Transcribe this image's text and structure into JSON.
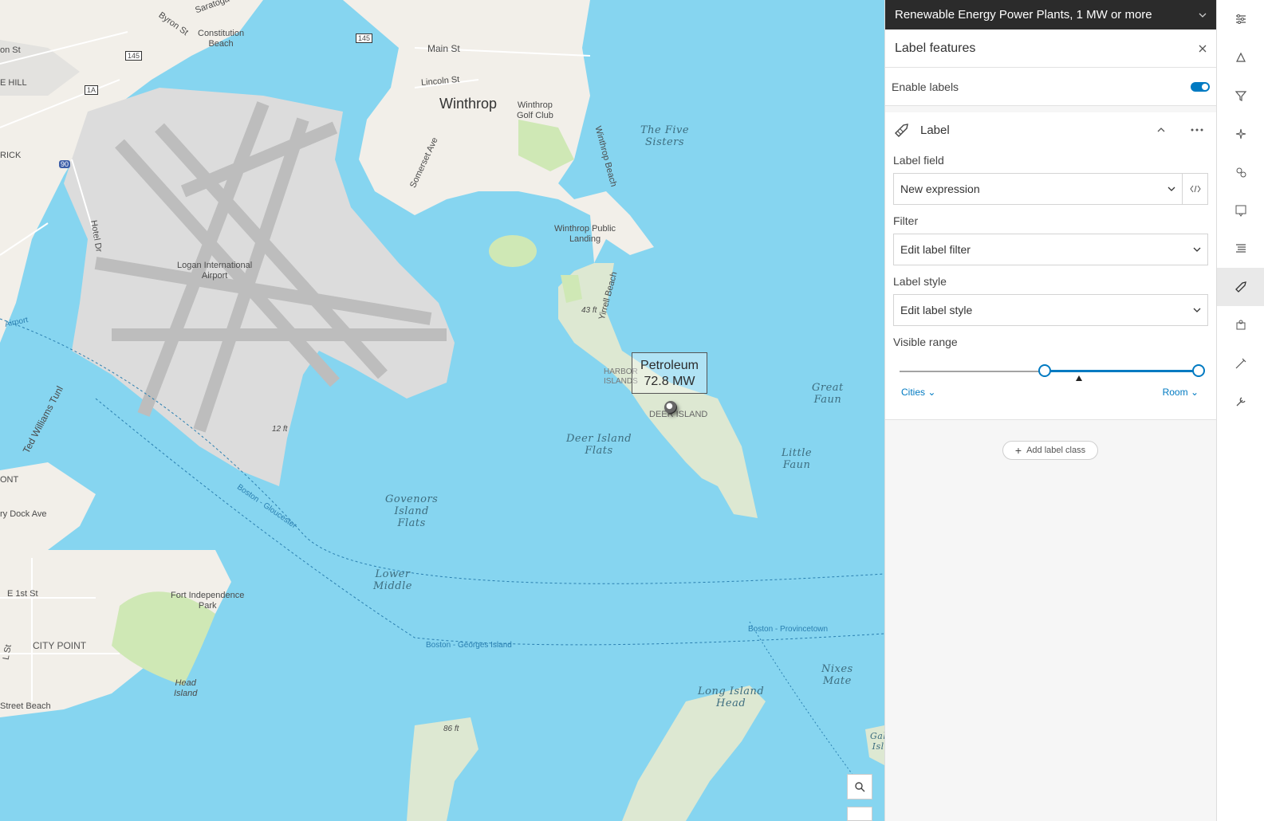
{
  "map": {
    "labels": {
      "constitution_beach": "Constitution\nBeach",
      "byron_st": "Byron St",
      "saratoga": "Saratoga",
      "main_st": "Main St",
      "lincoln_st": "Lincoln St",
      "winthrop": "Winthrop",
      "winthrop_golf": "Winthrop\nGolf Club",
      "winthrop_beach": "Winthrop Beach",
      "five_sisters": "The Five\nSisters",
      "somerset_ave": "Somerset Ave",
      "hotel_dr": "Hotel Dr",
      "logan": "Logan International\nAirport",
      "winthrop_landing": "Winthrop Public\nLanding",
      "yirrell_beach": "Yirrell Beach",
      "elev_43": "43 ft",
      "harbor_islands": "HARBOR\nISLANDS",
      "deer_island": "DEER ISLAND",
      "deer_island_flats": "Deer Island\nFlats",
      "great_faun": "Great\nFaun",
      "little_faun": "Little\nFaun",
      "elev_12": "12 ft",
      "ted_williams": "Ted Williams Tunl",
      "boston_gloucester": "Boston - Gloucester",
      "governors_flats": "Govenors\nIsland\nFlats",
      "lower_middle": "Lower\nMiddle",
      "fort_independence": "Fort Independence\nPark",
      "e_1st_st": "E 1st St",
      "city_point": "CITY POINT",
      "head_island": "Head\nIsland",
      "street_beach": "Street Beach",
      "boston_georges": "Boston - Georges Island",
      "boston_provincetown": "Boston - Provincetown",
      "nixes_mate": "Nixes\nMate",
      "long_island_head": "Long Island\nHead",
      "elev_86": "86 ft",
      "dry_dock": "ry Dock Ave",
      "e_hill": "E HILL",
      "rick": "RICK",
      "on_st": "on St",
      "ont": "ONT",
      "airport_road": "Airport",
      "gal_isl": "Gal\nIsl",
      "l_st": "L St",
      "shield_145a": "145",
      "shield_145b": "145",
      "shield_1a": "1A",
      "shield_90": "90"
    },
    "popup": {
      "title": "Petroleum",
      "value": "72.8 MW"
    },
    "colors": {
      "water": "#86d5f0",
      "land": "#f2efe9",
      "park": "#cfe8b5",
      "airport": "#dcdcdc",
      "runway": "#bdbdbd"
    }
  },
  "panel": {
    "layer_title": "Renewable Energy Power Plants, 1 MW or more",
    "title": "Label features",
    "enable_labels": "Enable labels",
    "enable_labels_on": true,
    "section_title": "Label",
    "label_field": {
      "label": "Label field",
      "value": "New expression"
    },
    "filter": {
      "label": "Filter",
      "value": "Edit label filter"
    },
    "label_style": {
      "label": "Label style",
      "value": "Edit label style"
    },
    "visible_range": {
      "label": "Visible range",
      "min_label": "Cities",
      "max_label": "Room"
    },
    "add_label_class": "Add label class",
    "accent": "#007ac2"
  },
  "rail": {
    "icons": [
      "properties-icon",
      "styles-icon",
      "filter-icon",
      "effects-icon",
      "aggregation-icon",
      "popups-icon",
      "fields-icon",
      "labels-icon",
      "forms-icon",
      "sketch-icon",
      "configure-icon"
    ],
    "active_index": 7
  }
}
